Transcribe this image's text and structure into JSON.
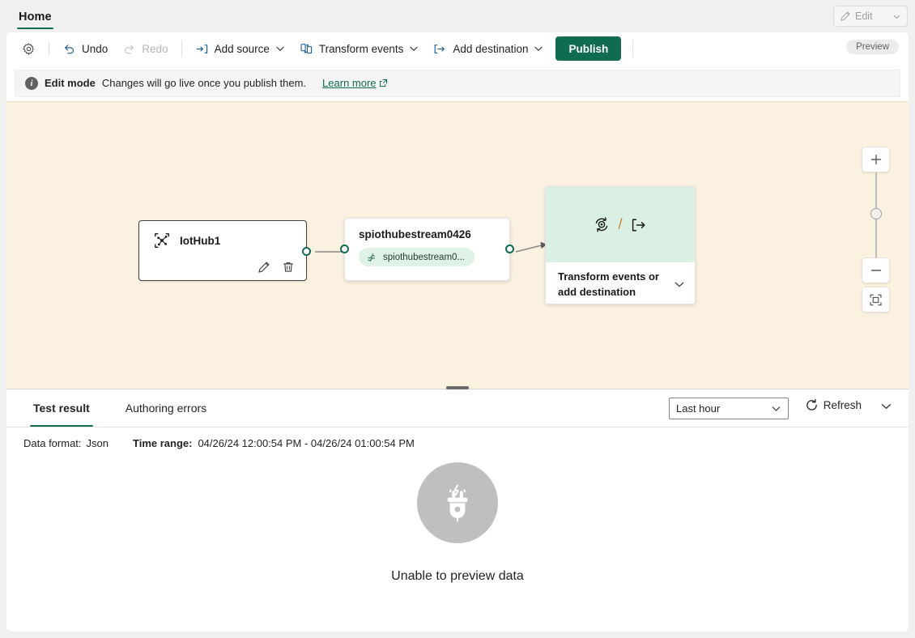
{
  "tabstrip": {
    "home_tab": "Home",
    "edit_button": {
      "label": "Edit",
      "icon": "pencil-icon",
      "chevron": "chevron-down-icon"
    }
  },
  "commandbar": {
    "settings_icon": "gear-icon",
    "undo": "Undo",
    "redo": "Redo",
    "add_source": "Add source",
    "transform_events": "Transform events",
    "add_destination": "Add destination",
    "publish": "Publish",
    "preview_badge": "Preview"
  },
  "editmode": {
    "icon": "info-icon",
    "title": "Edit mode",
    "message": "Changes will go live once you publish them.",
    "learn_more": "Learn more",
    "external_icon": "external-link-icon"
  },
  "canvas": {
    "background_color": "#faf1e0",
    "accent_color": "#0f6b52",
    "nodes": {
      "source": {
        "title": "IotHub1",
        "icon": "iot-hub-icon",
        "edit_icon": "pencil-icon",
        "delete_icon": "trash-icon"
      },
      "stream": {
        "title": "spiothubestream0426",
        "pill_label": "spiothubestream0...",
        "pill_icon": "eventstream-icon"
      },
      "transform": {
        "transform_icon": "transform-events-icon",
        "separator": "/",
        "destination_icon": "add-destination-icon",
        "label_line1": "Transform events or",
        "label_line2": "add destination",
        "chevron": "chevron-down-icon"
      }
    },
    "zoom_controls": {
      "zoom_in": "+",
      "zoom_out": "−",
      "fit_to_screen": "fit-to-screen-icon"
    }
  },
  "bottom_panel": {
    "tabs": [
      {
        "label": "Test result",
        "active": true
      },
      {
        "label": "Authoring errors",
        "active": false
      }
    ],
    "time_range_select": {
      "value": "Last hour",
      "chevron": "chevron-down-icon"
    },
    "refresh": {
      "label": "Refresh",
      "icon": "refresh-icon",
      "chevron": "chevron-down-icon"
    },
    "meta": {
      "data_format_label": "Data format:",
      "data_format_value": "Json",
      "time_range_label": "Time range:",
      "time_range_value": "04/26/24 12:00:54 PM - 04/26/24 01:00:54 PM"
    },
    "empty_state": {
      "icon": "plug-disconnected-icon",
      "message": "Unable to preview data"
    }
  }
}
